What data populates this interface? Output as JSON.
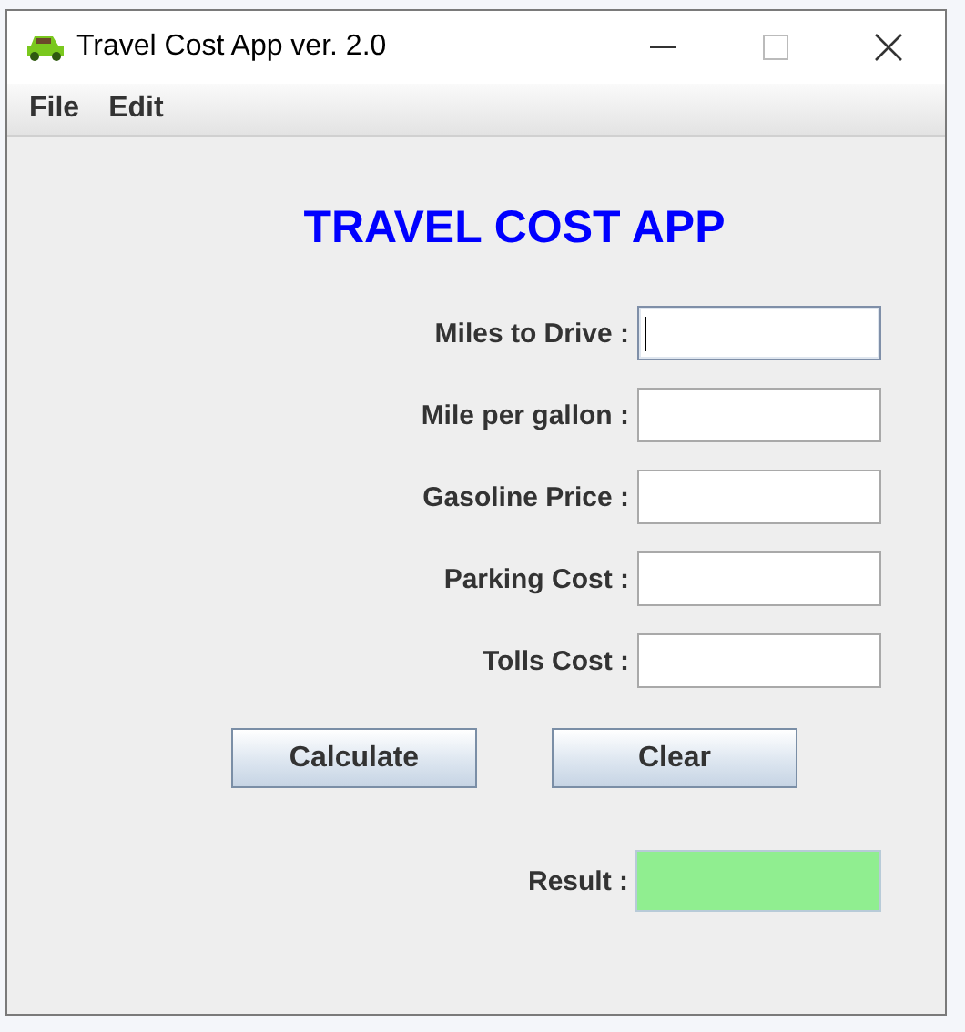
{
  "window": {
    "title": "Travel Cost App ver. 2.0"
  },
  "menu": [
    "File",
    "Edit"
  ],
  "heading": "TRAVEL COST APP",
  "fields": [
    {
      "label": "Miles to Drive :",
      "focused": true
    },
    {
      "label": "Mile per gallon :",
      "focused": false
    },
    {
      "label": "Gasoline Price :",
      "focused": false
    },
    {
      "label": "Parking Cost :",
      "focused": false
    },
    {
      "label": "Tolls Cost :",
      "focused": false
    }
  ],
  "buttons": [
    "Calculate",
    "Clear"
  ],
  "result": {
    "label": "Result :",
    "color": "#90ee90"
  }
}
